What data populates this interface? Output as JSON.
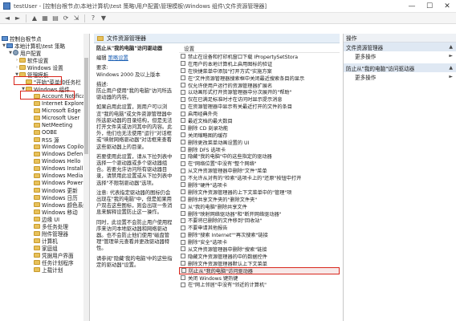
{
  "window": {
    "title": "testUser - [控制台根节点\\本地计算机\\test 策略\\用户配置\\管理模板\\Windows 组件\\文件资源管理器]",
    "minimize": "—",
    "maximize": "☐",
    "close": "✕"
  },
  "toolbar": {
    "buttons": [
      "back-icon",
      "forward-icon",
      "up-icon",
      "show-tree-icon",
      "properties-icon",
      "refresh-icon",
      "export-icon",
      "help-icon",
      "filter-icon"
    ]
  },
  "tree": {
    "items": [
      {
        "label": "控制台根节点",
        "icon": "console-root-icon"
      },
      {
        "label": "本地计算机\\test 策略",
        "icon": "policy-icon"
      },
      {
        "label": "用户配置",
        "icon": "user-icon"
      },
      {
        "label": "软件设置",
        "icon": "folder-icon"
      },
      {
        "label": "Windows 设置",
        "icon": "folder-icon"
      },
      {
        "label": "管理模板",
        "icon": "folder-icon"
      },
      {
        "label": "\"开始\"菜单和任务栏",
        "icon": "folder-icon"
      },
      {
        "label": "Windows 组件",
        "icon": "folder-icon"
      },
      {
        "label": "Account Notifica",
        "icon": "folder-icon"
      },
      {
        "label": "Internet Explorer",
        "icon": "folder-icon"
      },
      {
        "label": "Microsoft Edge",
        "icon": "folder-icon"
      },
      {
        "label": "Microsoft User",
        "icon": "folder-icon"
      },
      {
        "label": "NetMeeting",
        "icon": "folder-icon"
      },
      {
        "label": "OOBE",
        "icon": "folder-icon"
      },
      {
        "label": "RSS 源",
        "icon": "folder-icon"
      },
      {
        "label": "Windows Copilo",
        "icon": "folder-icon"
      },
      {
        "label": "Windows Defen",
        "icon": "folder-icon"
      },
      {
        "label": "Windows Hello",
        "icon": "folder-icon"
      },
      {
        "label": "Windows Install",
        "icon": "folder-icon"
      },
      {
        "label": "Windows Media",
        "icon": "folder-icon"
      },
      {
        "label": "Windows Power",
        "icon": "folder-icon"
      },
      {
        "label": "Windows 更新",
        "icon": "folder-icon"
      },
      {
        "label": "Windows 日历",
        "icon": "folder-icon"
      },
      {
        "label": "Windows 颜色系统",
        "icon": "folder-icon"
      },
      {
        "label": "Windows 移动",
        "icon": "folder-icon"
      },
      {
        "label": "边缘 UI",
        "icon": "folder-icon"
      },
      {
        "label": "多任务处理",
        "icon": "folder-icon"
      },
      {
        "label": "附件管理器",
        "icon": "folder-icon"
      },
      {
        "label": "计算机",
        "icon": "folder-icon"
      },
      {
        "label": "家庭组",
        "icon": "folder-icon"
      },
      {
        "label": "凭据用户界面",
        "icon": "folder-icon"
      },
      {
        "label": "任务计划程序",
        "icon": "folder-icon"
      },
      {
        "label": "上载计划",
        "icon": "folder-icon"
      }
    ]
  },
  "header": {
    "folder_title": "文件资源管理器"
  },
  "description": {
    "title": "防止从\"我的电脑\"访问驱动器",
    "edit_label": "编辑",
    "edit_link": "策略设置",
    "req_label": "要求:",
    "req_value": "Windows 2000 及以上版本",
    "desc_label": "描述:",
    "p1": "防止用户使用\"我的电脑\"访问所选驱动器的内容。",
    "p2": "如果启用此设置，则用户可以浏览\"我的电脑\"或文件资源管理器中所选驱动器的目录结构，但是无法打开文件夹或访问其中的内容。此外，他们也无法使用\"运行\"对话框或\"映射网络驱动器\"对话框来查看这些驱动器上的目录。",
    "p3": "若要使用此设置，请从下拉列表中选择一个驱动器或多个驱动器组合。若要允许访问所有驱动器目录，请禁用此设置或从下拉列表中选择\"不限制驱动器\"选项。",
    "p4": "注意: 代表指定驱动器的图标仍会出现在\"我的电脑\"中，但是如果用户双击这些图标，则会出现一条消息来解释设置防止这一操作。",
    "p5": "同时，此设置不会防止用户使用程序来访问本地驱动器和网络驱动器。也不会防止他们使用\"磁盘管理\"管理单元查看并更改驱动器特性。",
    "p6": "请参阅\"隐藏'我的电脑'中的这些指定的驱动器\"设置。"
  },
  "settings": {
    "column_header": "设置",
    "rows": [
      "禁止在设备和打印机窗口下载 IPropertySetStora",
      "在用户的本地计算机上启用图标的验证",
      "在快捷菜单中添加\"打开方式\"实施方案",
      "在\"文件资源管理器搜索框中关闭最近搜索条目的显示",
      "仅允许使用户运行的资源管理器扩展名",
      "以动画形式打开资源管理器中分次展开的\"帮助\"",
      "仅在已满足标准时才在访问时显示提示消息",
      "在资源管理器中显示有关最近打开的文件的条目",
      "启用经典外壳",
      "最近文档的最大数目",
      "删除 CD 刻录功能",
      "关闭缩略图的缓存",
      "删除更改菜单动画设置的 UI",
      "删除 DFS 选项卡",
      "隐藏\"我的电脑\"中的这些指定的驱动器",
      "在\"网络位置\"中没有\"整个网络\"",
      "从文件资源管理器中删除\"文件\"菜单",
      "不允许从对有的\"检索\"选项卡上的\"还原\"按钮中打开",
      "删除\"硬件\"选项卡",
      "删除文件资源管理器的上下文菜单中的\"管理\"项",
      "删除共享文件夹的\"删除文件夹\"",
      "从\"我的电脑\"删除共享文件",
      "删除\"映射网络驱动器\"和\"断开网络驱动器\"",
      "不要将已删除的文件移到\"回收站\"",
      "不要申请其他报告",
      "删除\"搜索 Internet\"\"再次搜索\"链接",
      "删除\"安全\"选项卡",
      "从文件资源管理器中删除\"搜索\"链接",
      "隐藏文件资源管理器的中的数据控件",
      "删除文件资源管理器默认上下文菜单",
      "防止从\"我的电脑\"访问驱动器",
      "关闭 Windows 键热键",
      "在\"网上邻居\"中没有\"邻近的计算机\""
    ]
  },
  "actions": {
    "header": "操作",
    "section1": "文件资源管理器",
    "more1": "更多操作",
    "section2": "防止从\"我的电脑\"访问驱动器",
    "more2": "更多操作"
  },
  "colors": {
    "highlight": "#d9261c",
    "selection": "#cce4f7",
    "link": "#1a5fb4"
  }
}
